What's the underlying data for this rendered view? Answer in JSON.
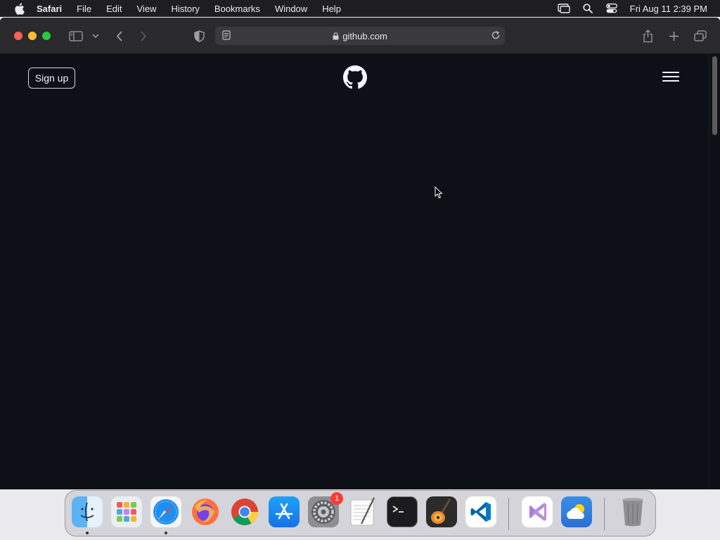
{
  "menubar": {
    "app_name": "Safari",
    "items": [
      "File",
      "Edit",
      "View",
      "History",
      "Bookmarks",
      "Window",
      "Help"
    ],
    "clock": "Fri Aug 11  2:39 PM",
    "icons": [
      "screen-mirroring-icon",
      "spotlight-search-icon",
      "control-center-icon"
    ]
  },
  "browser": {
    "url": "github.com",
    "traffic_colors": {
      "close": "#ff5f57",
      "minimize": "#febc2e",
      "maximize": "#28c840"
    }
  },
  "page": {
    "signup_label": "Sign up",
    "background": "#0d1117"
  },
  "dock": {
    "apps": [
      {
        "name": "Finder",
        "icon": "finder-icon"
      },
      {
        "name": "Launchpad",
        "icon": "launchpad-icon"
      },
      {
        "name": "Safari",
        "icon": "safari-icon"
      },
      {
        "name": "Firefox",
        "icon": "firefox-icon"
      },
      {
        "name": "Chrome",
        "icon": "chrome-icon"
      },
      {
        "name": "App Store",
        "icon": "app-store-icon"
      },
      {
        "name": "System Settings",
        "icon": "settings-icon",
        "badge": "1"
      },
      {
        "name": "TextEdit",
        "icon": "textedit-icon"
      },
      {
        "name": "Terminal",
        "icon": "terminal-icon"
      },
      {
        "name": "GarageBand",
        "icon": "garageband-icon"
      },
      {
        "name": "Visual Studio Code",
        "icon": "vscode-icon"
      },
      {
        "name": "Visual Studio",
        "icon": "visual-studio-icon"
      },
      {
        "name": "Weather",
        "icon": "weather-icon"
      },
      {
        "name": "Trash",
        "icon": "trash-icon"
      }
    ]
  }
}
